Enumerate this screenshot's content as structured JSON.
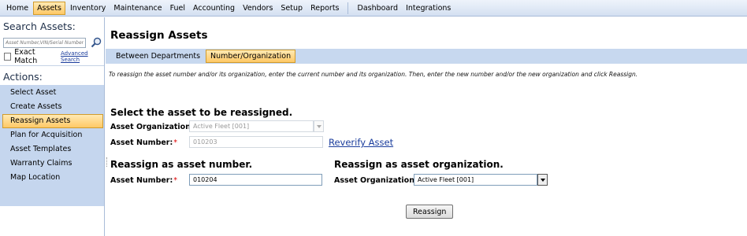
{
  "topmenu": {
    "items": [
      "Home",
      "Assets",
      "Inventory",
      "Maintenance",
      "Fuel",
      "Accounting",
      "Vendors",
      "Setup",
      "Reports"
    ],
    "items2": [
      "Dashboard",
      "Integrations"
    ]
  },
  "sidebar": {
    "search_title": "Search Assets:",
    "search_placeholder": "Asset Number,VIN/Serial Number",
    "exact_match_label": "Exact Match",
    "advanced_search_link": "Advanced Search",
    "actions_title": "Actions:",
    "actions": [
      "Select Asset",
      "Create Assets",
      "Reassign Assets",
      "Plan for Acquisition",
      "Asset Templates",
      "Warranty Claims",
      "Map Location"
    ]
  },
  "main": {
    "title": "Reassign Assets",
    "tabs": [
      "Between Departments",
      "Number/Organization"
    ],
    "instructions": "To reassign the asset number and/or its organization, enter the current number and its organization. Then, enter the new number and/or the new organization and click Reassign.",
    "select_section_title": "Select the asset to be reassigned.",
    "current_org_label": "Asset Organization:",
    "current_org_value": "Active Fleet [001]",
    "current_number_label": "Asset Number:",
    "current_number_value": "010203",
    "reverify_link": "Reverify Asset",
    "new_number_section_title": "Reassign as asset number.",
    "new_number_label": "Asset Number:",
    "new_number_value": "010204",
    "new_org_section_title": "Reassign as asset organization.",
    "new_org_label": "Asset Organization:",
    "new_org_value": "Active Fleet [001]",
    "reassign_button": "Reassign",
    "required_marker": "*"
  },
  "colors": {
    "accent_active": "#ffc966",
    "nav_panel_bg": "#c5d6ee",
    "link": "#1a3c9c",
    "required": "#dd0000"
  }
}
